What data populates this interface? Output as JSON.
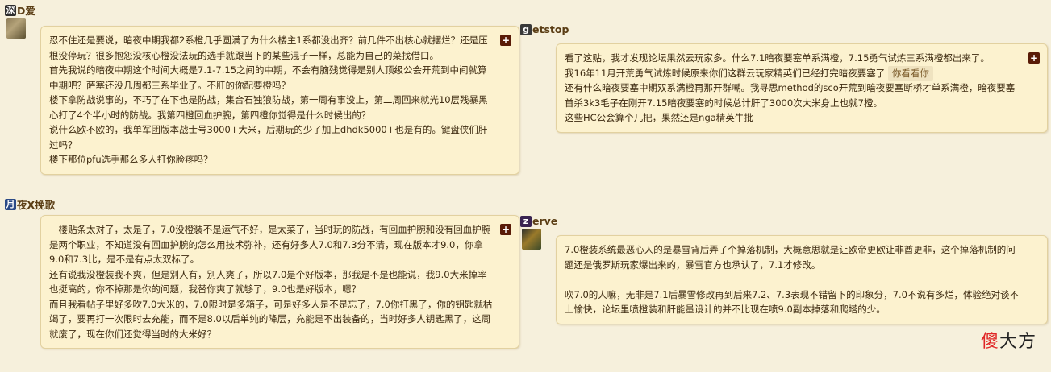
{
  "posts": [
    {
      "author_badge": "深",
      "author_badge_color": "#2d2d2d",
      "author_rest": "D爱",
      "avatar": "user-avatar-1",
      "lines": [
        "忍不住还是要说，暗夜中期我都2系橙几乎圆满了为什么楼主1系都没出齐？前几件不出核心就摆烂？还是压根没停玩？很多抱怨没核心橙没法玩的选手就跟当下的某些混子一样，总能为自己的菜找借口。",
        "首先我说的暗夜中期这个时间大概是7.1-7.15之间的中期，不会有脑残觉得是别人顶级公会开荒到中间就算中期吧？萨塞还没几周都三系毕业了。不肝的你配要橙吗？",
        "楼下拿防战说事的，不巧了在下也是防战，集合石独狼防战，第一周有事没上，第二周回来就光10层残暴黑心打了4个半小时的防战。我第四橙回血护腕，第四橙你觉得是什么时候出的？",
        "说什么欧不欧的，我单军团版本战士号3000+大米，后期玩的少了加上dhdk5000+也是有的。键盘侠们肝过吗？",
        "楼下那位pfu选手那么多人打你脸疼吗？"
      ]
    },
    {
      "author_badge": "g",
      "author_badge_color": "#3a3a3a",
      "author_rest": "etstop",
      "avatar": "",
      "lines": [
        "看了这贴，我才发现论坛果然云玩家多。什么7.1暗夜要塞单系满橙，7.15勇气试炼三系满橙都出来了。",
        "我16年11月开荒勇气试炼时候原来你们这群云玩家精英们已经打完暗夜要塞了",
        "还有什么暗夜要塞中期双系满橙再那开群嘲。我寻思method的sco开荒到暗夜要塞断桥才单系满橙，暗夜要塞首杀3k3毛子在刚开7.15暗夜要塞的时候总计肝了3000次大米身上也就7橙。",
        "这些HC公会算个几把，果然还是nga精英牛批"
      ],
      "quote_link": "你看看你"
    },
    {
      "author_badge": "月",
      "author_badge_color": "#2b4a86",
      "author_rest": "夜X挽歌",
      "avatar": "",
      "lines": [
        "一楼贴条太对了，太是了，7.0没橙装不是运气不好，是太菜了，当时玩的防战，有回血护腕和没有回血护腕是两个职业，不知道没有回血护腕的怎么用技术弥补，还有好多人7.0和7.3分不清，现在版本才9.0，你拿9.0和7.3比，是不是有点太双标了。",
        "还有说我没橙装我不爽，但是别人有，别人爽了，所以7.0是个好版本，那我是不是也能说，我9.0大米掉率也挺高的，你不掉那是你的问题，我替你爽了就够了，9.0也是好版本，嗯？",
        "而且我看帖子里好多吹7.0大米的，7.0限时是多箱子，可是好多人是不是忘了，7.0你打黑了，你的钥匙就枯竭了，要再打一次限时去充能，而不是8.0以后单纯的降层，充能是不出装备的，当时好多人钥匙黑了，这周就废了，现在你们还觉得当时的大米好？"
      ]
    },
    {
      "author_badge": "z",
      "author_badge_color": "#3a2452",
      "author_rest": "erve",
      "avatar": "user-avatar-2",
      "lines": [
        "7.0橙装系统最恶心人的是暴雪背后弄了个掉落机制，大概意思就是让欧帝更欧让非酋更非，这个掉落机制的问题还是俄罗斯玩家爆出来的，暴雪官方也承认了，7.1才修改。",
        "",
        "吹7.0的人嘛，无非是7.1后暴雪修改再到后来7.2、7.3表现不错留下的印象分，7.0不说有多烂，体验绝对谈不上愉快，论坛里喷橙装和肝能量设计的并不比现在喷9.0副本掉落和爬塔的少。"
      ]
    }
  ],
  "plus_label": "+",
  "watermark": {
    "part1": "傻",
    "part2": "大方"
  }
}
